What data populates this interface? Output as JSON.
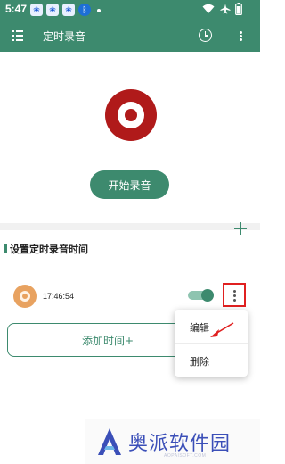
{
  "status_bar": {
    "time": "5:47",
    "notification_apps": [
      "baidu-app-icon",
      "baidu-app-icon",
      "baidu-app-icon",
      "bluetooth-icon"
    ],
    "right_icons": [
      "wifi-icon",
      "airplane-icon",
      "battery-icon"
    ]
  },
  "app_bar": {
    "title": "定时录音",
    "left_icon": "menu-icon",
    "right_icons": [
      "clock-icon",
      "more-vert-icon"
    ]
  },
  "recorder": {
    "logo_icon": "record-logo",
    "start_label": "开始录音"
  },
  "schedule": {
    "section_title": "设置定时录音时间",
    "add_icon": "plus-icon",
    "timers": [
      {
        "time": "17:46:54",
        "enabled": true
      }
    ],
    "add_time_label": "添加时间+"
  },
  "popup_menu": {
    "items": [
      "编辑",
      "删除"
    ]
  },
  "watermark": {
    "text": "奥派软件园",
    "url": "AOPAISOFT.COM"
  },
  "colors": {
    "primary": "#3d8a6e",
    "record_red": "#b01a1a",
    "highlight_red": "#e02020",
    "watermark_blue": "#3b4fb8"
  }
}
